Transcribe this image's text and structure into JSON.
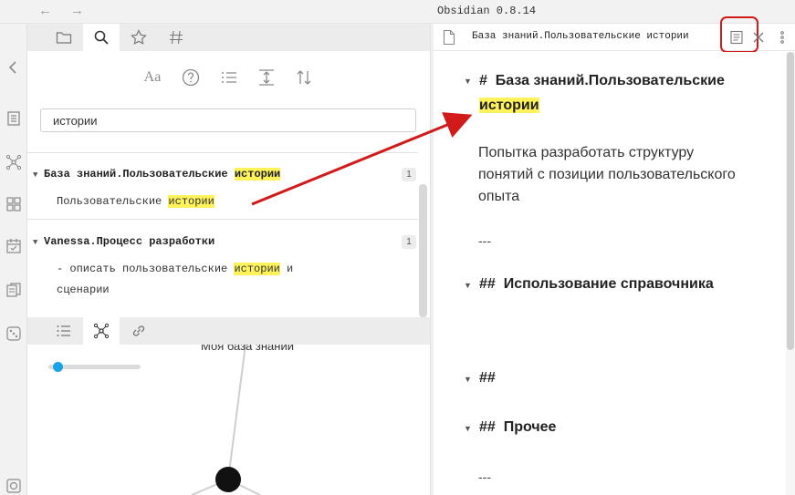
{
  "titlebar": {
    "app_title": "Obsidian 0.8.14",
    "back_glyph": "←",
    "forward_glyph": "→"
  },
  "ribbon": {
    "icons": [
      "collapse-icon",
      "switcher-icon",
      "graph-icon",
      "plugins-icon",
      "calendar-icon",
      "copy-icon",
      "dice-icon",
      "vault-icon"
    ]
  },
  "left_tabs": [
    "file-explorer-icon",
    "search-icon",
    "star-icon",
    "tag-icon"
  ],
  "search": {
    "toolbar_aa": "Aa",
    "query": "истории",
    "results": [
      {
        "file_prefix": "База знаний.Пользовательские ",
        "file_hit": "истории",
        "count": "1",
        "matches": [
          {
            "before": "Пользовательские ",
            "hit": "истории",
            "after": ""
          }
        ]
      },
      {
        "file_prefix": "Vanessa.Процесс разработки",
        "file_hit": "",
        "count": "1",
        "match_line1_before": "- описать пользовательские ",
        "match_line1_hit": "истории",
        "match_line1_after": " и",
        "match_line2": "сценарии"
      }
    ]
  },
  "bottom_tabs": [
    "outline-icon",
    "local-graph-icon",
    "backlinks-icon"
  ],
  "graph": {
    "node_label": "Моя база знаний",
    "zoom_level": 0.05
  },
  "doc": {
    "title": "База знаний.Пользовательские истории",
    "heading1_marker": "#",
    "heading1_prefix": "База знаний.Пользовательские",
    "heading1_hit": "истории",
    "paragraph": "Попытка разработать структуру понятий с позиции пользовательского опыта",
    "rule1": "---",
    "heading2_marker": "##",
    "heading2_text": "Использование справочника",
    "heading3_marker": "##",
    "heading4_marker": "##",
    "heading4_text": "Прочее",
    "rule2": "---"
  },
  "colors": {
    "highlight": "#fff35c",
    "annotation_red": "#d31a1a",
    "slider_blue": "#1aa3e8",
    "node_black": "#111111"
  }
}
